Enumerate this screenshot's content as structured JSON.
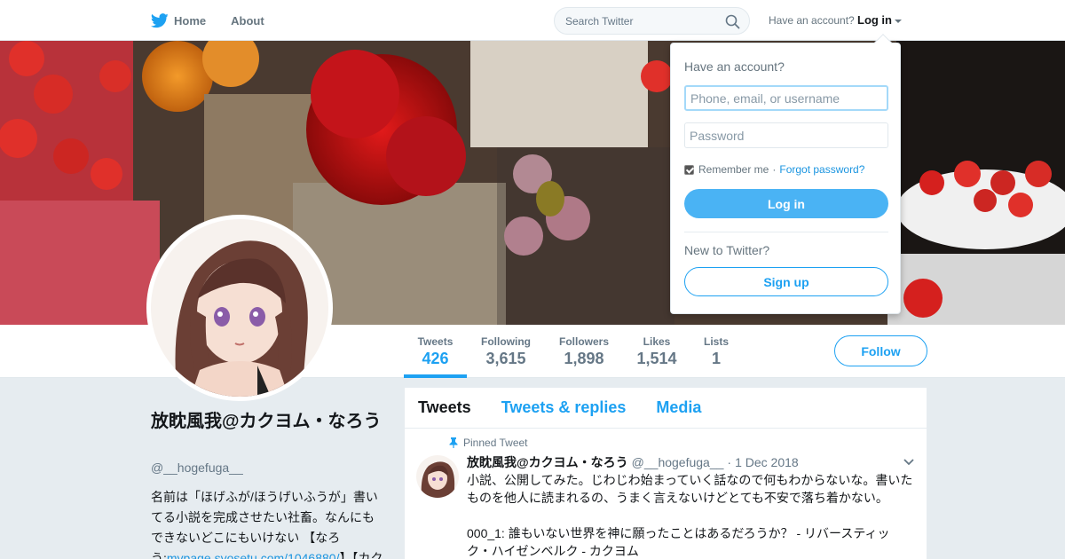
{
  "nav": {
    "home_label": "Home",
    "about_label": "About",
    "search_placeholder": "Search Twitter",
    "have_account_text": "Have an account?",
    "login_label": "Log in"
  },
  "profile": {
    "display_name": "放眈風我@カクヨム・なろう",
    "handle": "@__hogefuga__",
    "bio_text": "名前は「ほげふが/ほうげいふうが」書いてる小説を完成させたい社畜。なんにもできないどこにもいけない 【なろう:",
    "bio_link": "mypage.syosetu.com/1046880/",
    "bio_tail": "】【カク"
  },
  "stats": [
    {
      "label": "Tweets",
      "value": "426"
    },
    {
      "label": "Following",
      "value": "3,615"
    },
    {
      "label": "Followers",
      "value": "1,898"
    },
    {
      "label": "Likes",
      "value": "1,514"
    },
    {
      "label": "Lists",
      "value": "1"
    }
  ],
  "follow_label": "Follow",
  "timeline": {
    "tabs": [
      "Tweets",
      "Tweets & replies",
      "Media"
    ],
    "pinned_label": "Pinned Tweet",
    "tweet": {
      "name": "放眈風我@カクヨム・なろう",
      "handle": "@__hogefuga__",
      "date": "1 Dec 2018",
      "line1": "小説、公開してみた。じわじわ始まっていく話なので何もわからないな。書いた",
      "line2": "ものを他人に読まれるの、うまく言えないけどとても不安で落ち着かない。",
      "line3": "000_1: 誰もいない世界を神に願ったことはあるだろうか？ - リバースティッ",
      "line4": "ク・ハイゼンベルク - カクヨム"
    }
  },
  "login_dropdown": {
    "title": "Have an account?",
    "username_placeholder": "Phone, email, or username",
    "password_placeholder": "Password",
    "remember_label": "Remember me",
    "separator": "·",
    "forgot_label": "Forgot password?",
    "login_button": "Log in",
    "new_label": "New to Twitter?",
    "signup_button": "Sign up"
  },
  "colors": {
    "accent": "#1da1f2",
    "login_button_bg": "#4ab3f4",
    "page_bg": "#e6ecf0"
  }
}
